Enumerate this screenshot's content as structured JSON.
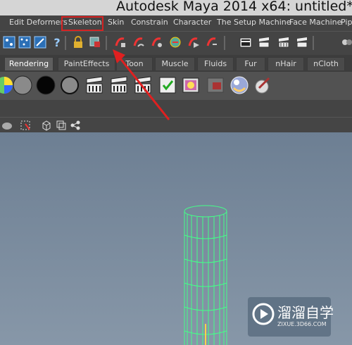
{
  "window": {
    "title": "Autodesk Maya 2014 x64: untitled*"
  },
  "menu": [
    "Edit Deformers",
    "Skeleton",
    "Skin",
    "Constrain",
    "Character",
    "The Setup Machine",
    "Face Machine",
    "Pip"
  ],
  "highlighted_menu": "Skeleton",
  "shelf_tabs": [
    "Rendering",
    "PaintEffects",
    "Toon",
    "Muscle",
    "Fluids",
    "Fur",
    "nHair",
    "nCloth"
  ],
  "active_tab": "Rendering",
  "toolbar_icons": [
    "select-by-hierarchy-icon",
    "select-by-object-icon",
    "select-by-component-icon",
    "help-icon",
    "lock-icon",
    "highlight-selection-icon",
    "snap-to-grid-icon",
    "snap-to-curve-icon",
    "snap-to-point-icon",
    "snap-to-view-icon",
    "make-live-icon",
    "magnet-icon",
    "render-icon",
    "ipr-render-icon",
    "render-settings-icon",
    "hypershade-icon"
  ],
  "shelf_icons": [
    "color-sphere-icon",
    "gray-sphere-icon",
    "black-sphere-icon",
    "gray-circle-icon",
    "clapper-icon",
    "clapper-icon",
    "clapper-icon",
    "clapper-check-icon",
    "render-view-icon",
    "disabled-render-icon",
    "shader-ball-icon",
    "paint-brush-icon"
  ],
  "colors": {
    "highlight": "#d62222",
    "mesh_wire": "#44ff88",
    "viewport_top": "#6d7f93",
    "viewport_bottom": "#8797a8",
    "arrow": "#e02020"
  },
  "watermark": {
    "title": "溜溜自学",
    "subtitle": "ZIXUE.3D66.COM"
  }
}
